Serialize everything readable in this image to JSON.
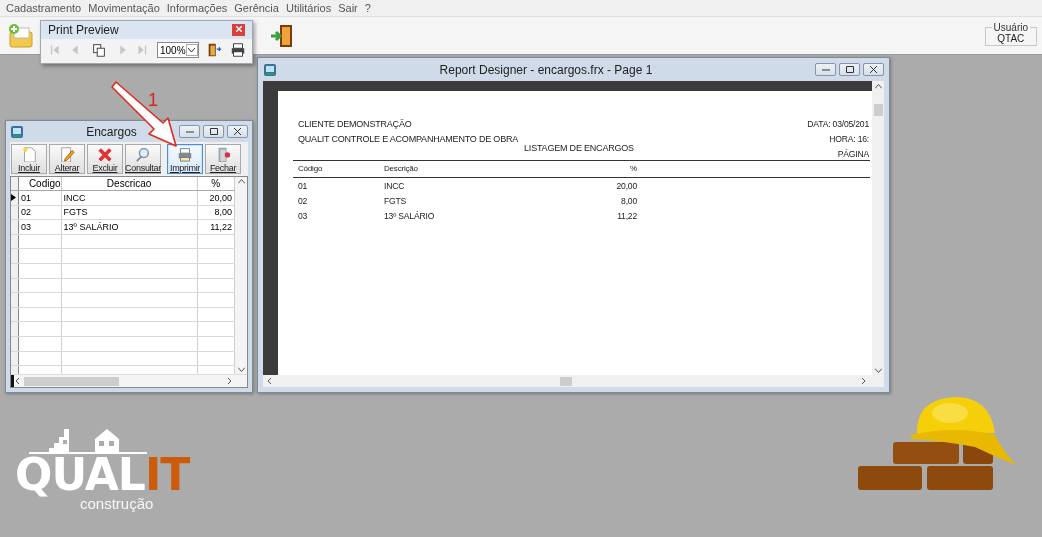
{
  "menu": [
    "Cadastramento",
    "Movimentação",
    "Informações",
    "Gerência",
    "Utilitários",
    "Sair",
    "?"
  ],
  "toolbar": {
    "user": {
      "label": "Usuário",
      "value": "QTAC"
    }
  },
  "print_preview": {
    "title": "Print Preview",
    "zoom": "100%",
    "buttons": [
      {
        "kind": "first",
        "disabled": true
      },
      {
        "kind": "prev",
        "disabled": true
      },
      {
        "kind": "pages",
        "disabled": false
      },
      {
        "kind": "next",
        "disabled": true
      },
      {
        "kind": "last",
        "disabled": true
      },
      {
        "kind": "zoom",
        "disabled": false
      },
      {
        "kind": "exit",
        "disabled": false
      },
      {
        "kind": "print",
        "disabled": false
      }
    ]
  },
  "encargos": {
    "title": "Encargos",
    "buttons": [
      {
        "label": "Incluir",
        "kind": "new",
        "focused": false
      },
      {
        "label": "Alterar",
        "kind": "edit",
        "focused": false
      },
      {
        "label": "Excluir",
        "kind": "delete",
        "focused": false
      },
      {
        "label": "Consultar",
        "kind": "search",
        "focused": false
      },
      {
        "label": "Imprimir",
        "kind": "print",
        "focused": true
      },
      {
        "label": "Fechar",
        "kind": "close",
        "focused": false
      }
    ],
    "columns": [
      "Codigo",
      "Descricao",
      "%"
    ],
    "rows": [
      {
        "cells": [
          "01",
          "INCC",
          "20,00"
        ],
        "current": true
      },
      {
        "cells": [
          "02",
          "FGTS",
          "8,00"
        ],
        "current": false
      },
      {
        "cells": [
          "03",
          "13º SALÁRIO",
          "11,22"
        ],
        "current": false
      }
    ]
  },
  "annotation": {
    "number": "1"
  },
  "report": {
    "title": "Report Designer - encargos.frx - Page 1",
    "header_left": [
      "CLIENTE DEMONSTRAÇÃO",
      "QUALIT CONTROLE E ACOMPANHAMENTO DE OBRA"
    ],
    "header_right": [
      "DATA: 03/05/201",
      "HORA: 16:",
      "PÁGINA"
    ],
    "heading": "LISTAGEM DE ENCARGOS",
    "columns": [
      "Código",
      "Descrição",
      "%"
    ],
    "rows": [
      [
        "01",
        "INCC",
        "20,00"
      ],
      [
        "02",
        "FGTS",
        "8,00"
      ],
      [
        "03",
        "13º SALÁRIO",
        "11,22"
      ]
    ]
  },
  "logo": {
    "wordmark": [
      {
        "text": "QUAL",
        "color": "#ffffff"
      },
      {
        "text": "IT",
        "color": "#cc5c0c"
      }
    ],
    "tagline": "construção"
  }
}
